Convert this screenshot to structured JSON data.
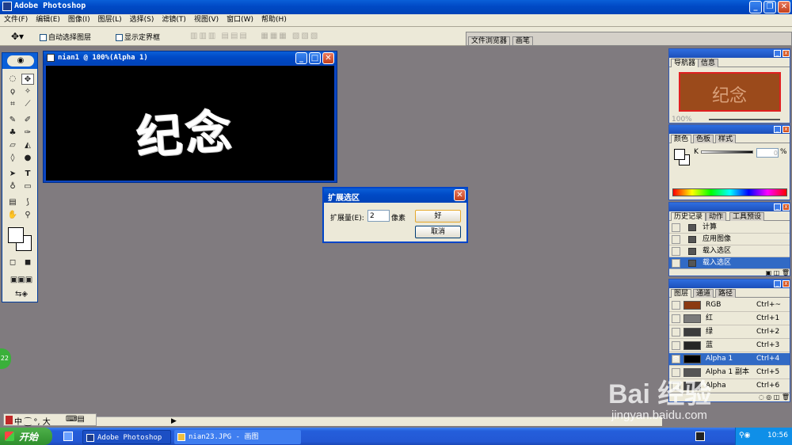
{
  "app": {
    "title": "Adobe Photoshop"
  },
  "menu": [
    "文件(F)",
    "编辑(E)",
    "图像(I)",
    "图层(L)",
    "选择(S)",
    "滤镜(T)",
    "视图(V)",
    "窗口(W)",
    "帮助(H)"
  ],
  "options": {
    "auto_select": "自动选择图层",
    "show_bounds": "显示定界框"
  },
  "well_tabs": [
    "文件浏览器",
    "画笔"
  ],
  "document": {
    "title": "nian1 @ 100%(Alpha 1)",
    "text": "纪念"
  },
  "dialog": {
    "title": "扩展选区",
    "label": "扩展量(E):",
    "value": "2",
    "unit": "像素",
    "ok": "好",
    "cancel": "取消"
  },
  "navigator": {
    "tabs": [
      "导航器",
      "信息"
    ],
    "preview_text": "纪念",
    "zoom": "100%"
  },
  "color": {
    "tabs": [
      "颜色",
      "色板",
      "样式"
    ],
    "channel": "K",
    "value": "0",
    "unit": "%"
  },
  "history": {
    "tabs": [
      "历史记录",
      "动作",
      "工具预设"
    ],
    "items": [
      {
        "label": "计算"
      },
      {
        "label": "应用图像"
      },
      {
        "label": "载入选区"
      },
      {
        "label": "载入选区"
      }
    ]
  },
  "channels": {
    "tabs": [
      "图层",
      "通道",
      "路径"
    ],
    "items": [
      {
        "name": "RGB",
        "shortcut": "Ctrl+~",
        "thumb": "#8b3a12"
      },
      {
        "name": "红",
        "shortcut": "Ctrl+1",
        "thumb": "#7a7a7a"
      },
      {
        "name": "绿",
        "shortcut": "Ctrl+2",
        "thumb": "#3c3c3c"
      },
      {
        "name": "蓝",
        "shortcut": "Ctrl+3",
        "thumb": "#262626"
      },
      {
        "name": "Alpha 1",
        "shortcut": "Ctrl+4",
        "thumb": "#000000"
      },
      {
        "name": "Alpha 1 副本",
        "shortcut": "Ctrl+5",
        "thumb": "#555555"
      },
      {
        "name": "Alpha",
        "shortcut": "Ctrl+6",
        "thumb": "#444444"
      }
    ]
  },
  "ime": {
    "text": "中 ⁐ °, 大"
  },
  "side_badge": "22",
  "taskbar": {
    "start": "开始",
    "items": [
      "Adobe Photoshop",
      "nian23.JPG - 画图"
    ],
    "clock": "10:56"
  },
  "watermark": {
    "brand": "Bai 经验",
    "url": "jingyan.baidu.com"
  },
  "colors": {
    "canvas_bg": "#807b7f",
    "selection": "#316ac5",
    "xp_blue": "#0a5fd8"
  }
}
